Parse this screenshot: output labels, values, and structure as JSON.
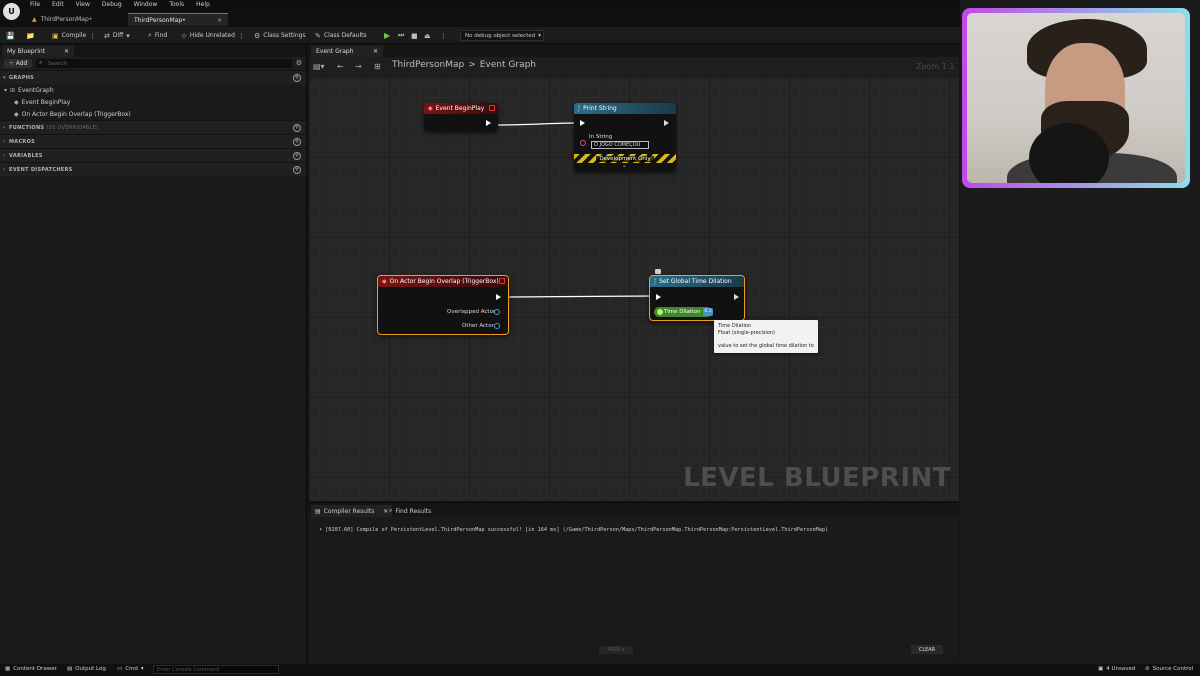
{
  "menu": [
    "File",
    "Edit",
    "View",
    "Debug",
    "Window",
    "Tools",
    "Help"
  ],
  "doc_tabs": [
    {
      "label": "ThirdPersonMap•"
    },
    {
      "label": "ThirdPersonMap•"
    }
  ],
  "toolbar": {
    "compile": "Compile",
    "diff": "Diff",
    "find": "Find",
    "hide_unrelated": "Hide Unrelated",
    "class_settings": "Class Settings",
    "class_defaults": "Class Defaults",
    "debug_object": "No debug object selected"
  },
  "left_panel": {
    "tab": "My Blueprint",
    "add": "Add",
    "search_placeholder": "Search",
    "graphs_header": "GRAPHS",
    "event_graph": "EventGraph",
    "items": [
      "Event BeginPlay",
      "On Actor Begin Overlap (TriggerBox)"
    ],
    "functions_header": "FUNCTIONS",
    "functions_overridable": "(20 OVERRIDABLE)",
    "macros_header": "MACROS",
    "variables_header": "VARIABLES",
    "dispatchers_header": "EVENT DISPATCHERS"
  },
  "graph": {
    "tab": "Event Graph",
    "breadcrumb_root": "ThirdPersonMap",
    "breadcrumb_sep": ">",
    "breadcrumb_leaf": "Event Graph",
    "zoom": "Zoom 1:1",
    "watermark": "LEVEL BLUEPRINT"
  },
  "nodes": {
    "begin_play": {
      "title": "Event BeginPlay"
    },
    "print_string": {
      "title": "Print String",
      "in_string_label": "In String",
      "in_string_value": "O JOGO COMEÇOU",
      "dev_only": "Development Only"
    },
    "overlap": {
      "title": "On Actor Begin Overlap (TriggerBox)",
      "overlapped": "Overlapped Actor",
      "other": "Other Actor"
    },
    "time_dilation": {
      "title": "Set Global Time Dilation",
      "pin": "Time Dilation",
      "value": "0.1"
    }
  },
  "tooltip": {
    "line1": "Time Dilation",
    "line2": "Float (single-precision)",
    "line3": "value to set the global time dilation to"
  },
  "bottom": {
    "tab1": "Compiler Results",
    "tab2": "Find Results",
    "log": "• [0207.60] Compile of PersistentLevel.ThirdPersonMap successful! [in 164 ms] (/Game/ThirdPerson/Maps/ThirdPersonMap.ThirdPersonMap:PersistentLevel.ThirdPersonMap)",
    "page": "PAGE",
    "clear": "CLEAR"
  },
  "status": {
    "content_drawer": "Content Drawer",
    "output_log": "Output Log",
    "cmd": "Cmd",
    "console_placeholder": "Enter Console Command",
    "unsaved": "4 Unsaved",
    "source_control": "Source Control"
  }
}
